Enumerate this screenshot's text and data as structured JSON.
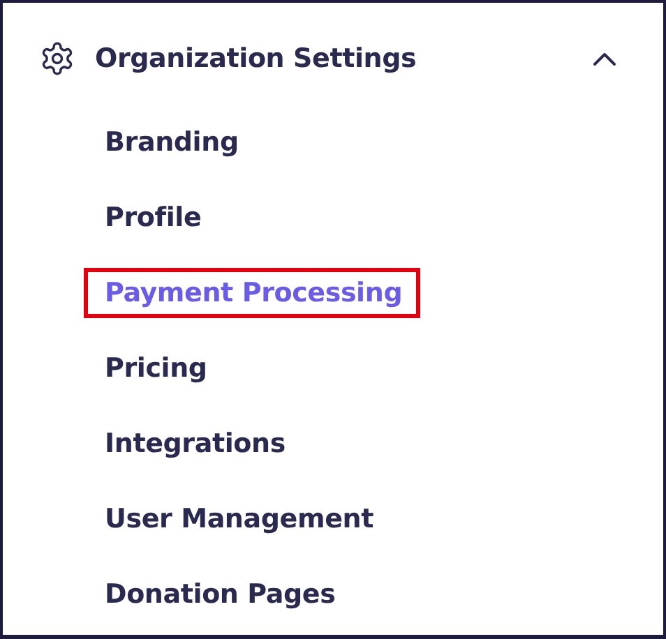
{
  "section": {
    "title": "Organization Settings",
    "expanded": true,
    "items": [
      {
        "label": "Branding",
        "selected": false,
        "highlighted": false
      },
      {
        "label": "Profile",
        "selected": false,
        "highlighted": false
      },
      {
        "label": "Payment Processing",
        "selected": true,
        "highlighted": true
      },
      {
        "label": "Pricing",
        "selected": false,
        "highlighted": false
      },
      {
        "label": "Integrations",
        "selected": false,
        "highlighted": false
      },
      {
        "label": "User Management",
        "selected": false,
        "highlighted": false
      },
      {
        "label": "Donation Pages",
        "selected": false,
        "highlighted": false
      }
    ]
  }
}
